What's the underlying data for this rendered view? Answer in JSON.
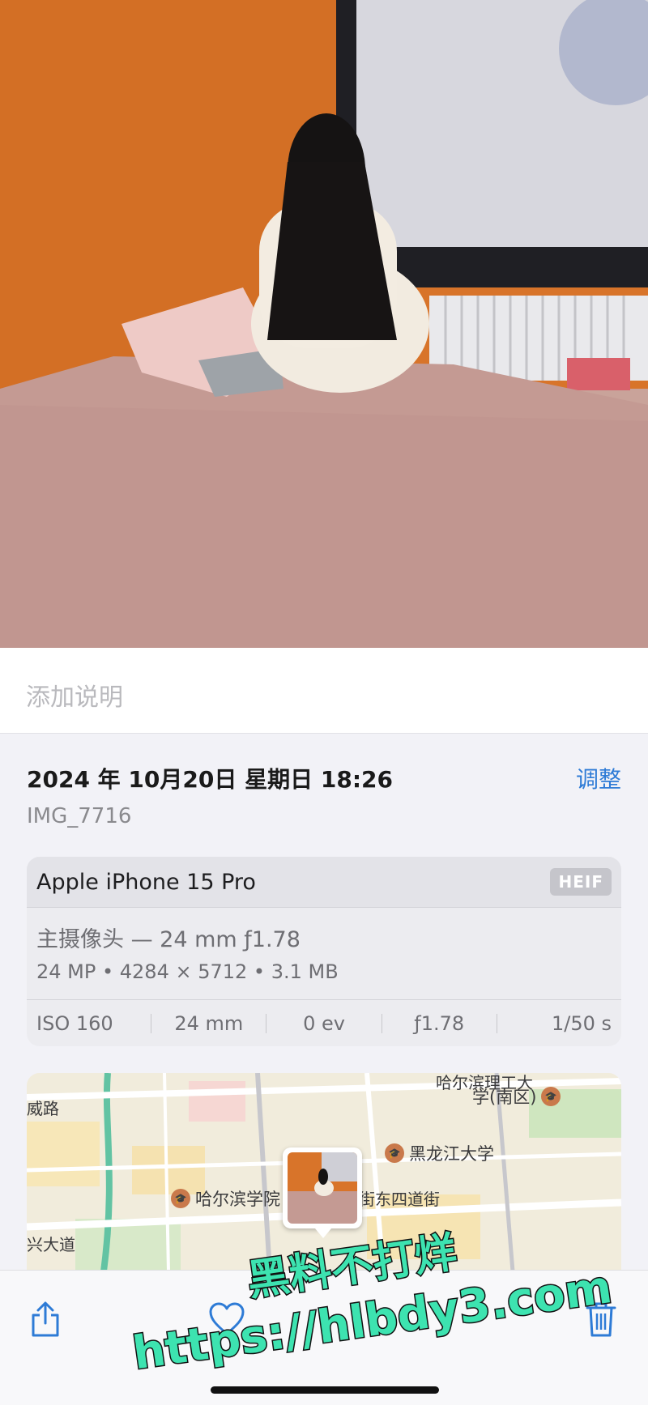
{
  "caption": {
    "placeholder": "添加说明"
  },
  "info": {
    "date": "2024 年 10月20日 星期日 18:26",
    "adjust_label": "调整",
    "filename": "IMG_7716"
  },
  "camera": {
    "device": "Apple iPhone 15 Pro",
    "format_badge": "HEIF",
    "lens": "主摄像头 — 24 mm ƒ1.78",
    "specs": "24 MP • 4284 × 5712 • 3.1 MB",
    "exif": [
      "ISO 160",
      "24 mm",
      "0 ev",
      "ƒ1.78",
      "1/50 s"
    ]
  },
  "map": {
    "labels": {
      "road_west": "威路",
      "university_top_1": "哈尔滨理工大",
      "university_top_2": "学(南区)",
      "heilongjiang": "黑龙江大学",
      "harbin_college": "哈尔滨学院",
      "street": "街东四道街",
      "avenue": "兴大道"
    }
  },
  "toolbar": {
    "share_icon": "share-icon",
    "favorite_icon": "heart-icon",
    "delete_icon": "trash-icon"
  },
  "watermark": {
    "line1": "黑料不打烊",
    "line2": "https://hlbdy3.com"
  },
  "colors": {
    "accent": "#2e7bd6",
    "watermark": "#3de3b0"
  }
}
